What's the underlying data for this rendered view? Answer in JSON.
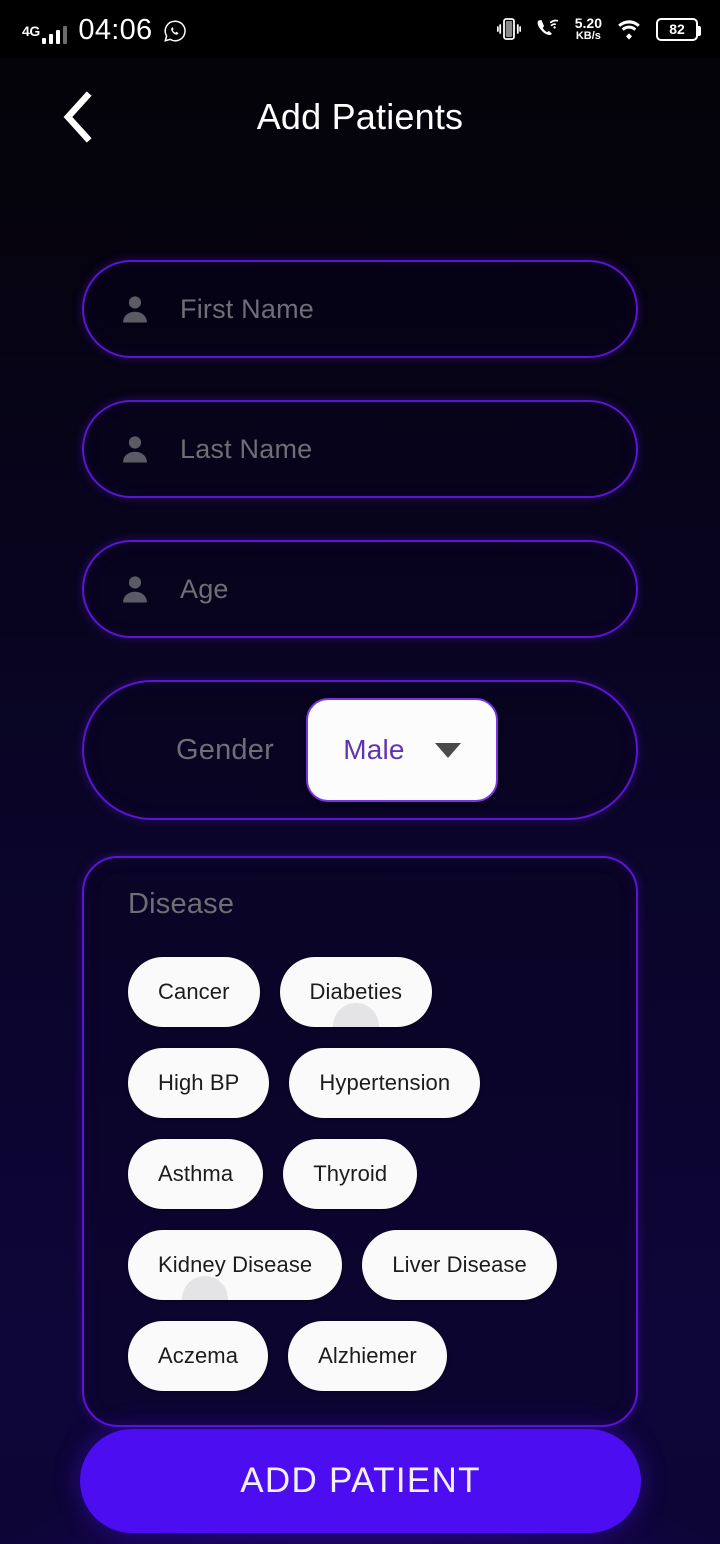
{
  "statusbar": {
    "network_type": "4G",
    "time": "04:06",
    "whatsapp_icon": "whatsapp-icon",
    "vibrate_icon": "vibrate-icon",
    "wifi_calling_icon": "wifi-calling-icon",
    "data_speed_value": "5.20",
    "data_speed_unit": "KB/s",
    "wifi_icon": "wifi-icon",
    "battery_level": "82"
  },
  "header": {
    "back_icon": "chevron-left-icon",
    "title": "Add Patients"
  },
  "form": {
    "fields": [
      {
        "name": "first-name",
        "placeholder": "First Name",
        "value": "",
        "icon": "person-icon"
      },
      {
        "name": "last-name",
        "placeholder": "Last Name",
        "value": "",
        "icon": "person-icon"
      },
      {
        "name": "age",
        "placeholder": "Age",
        "value": "",
        "icon": "person-icon"
      }
    ],
    "gender": {
      "label": "Gender",
      "selected": "Male",
      "options": [
        "Male"
      ],
      "caret_icon": "chevron-down-icon"
    },
    "disease": {
      "label": "Disease",
      "chips": [
        "Cancer",
        "Diabeties",
        "High BP",
        "Hypertension",
        "Asthma",
        "Thyroid",
        "Kidney Disease",
        "Liver Disease",
        "Aczema",
        "Alzhiemer"
      ]
    },
    "submit_label": "ADD PATIENT"
  },
  "colors": {
    "accent_purple": "#5c14d6",
    "button_purple": "#4c0ef0",
    "dropdown_text": "#5e35b1",
    "placeholder_gray": "#6e6e76",
    "chip_bg": "#fafafa",
    "background_top": "#040308",
    "background_bottom": "#0d0535"
  }
}
